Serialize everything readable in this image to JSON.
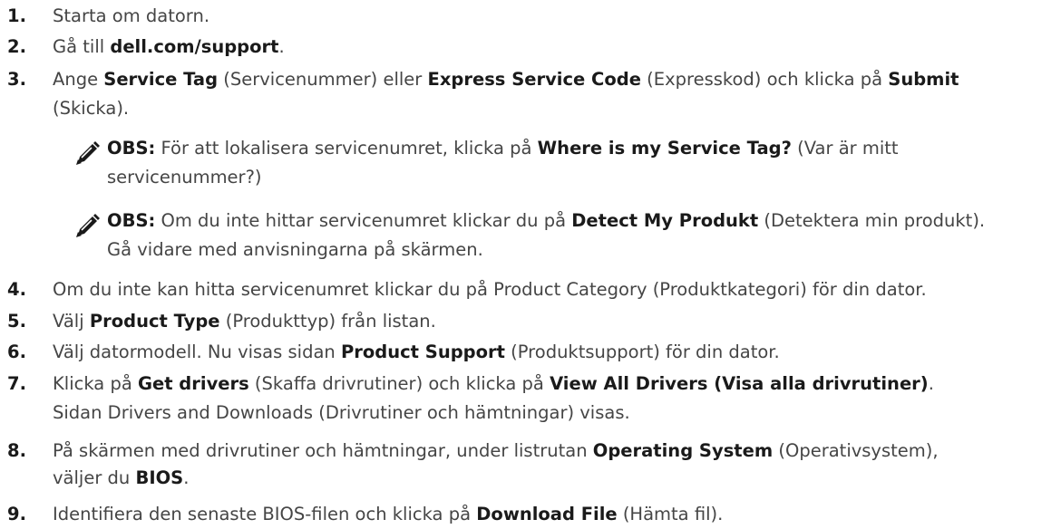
{
  "steps": [
    {
      "num": "1.",
      "parts": [
        "Starta om datorn."
      ]
    },
    {
      "num": "2.",
      "parts": [
        "Gå till ",
        "dell.com/support",
        "."
      ]
    },
    {
      "num": "3.",
      "line1": [
        "Ange ",
        "Service Tag",
        " (Servicenummer) eller ",
        "Express Service Code",
        " (Expresskod) och klicka på ",
        "Submit"
      ],
      "line2": "(Skicka)."
    },
    {
      "num": "4.",
      "parts": [
        "Om du inte kan hitta servicenumret klickar du på Product Category (Produktkategori) för din dator."
      ]
    },
    {
      "num": "5.",
      "parts": [
        "Välj ",
        "Product Type",
        " (Produkttyp) från listan."
      ]
    },
    {
      "num": "6.",
      "parts": [
        "Välj datormodell. Nu visas sidan ",
        "Product Support",
        " (Produktsupport) för din dator."
      ]
    },
    {
      "num": "7.",
      "parts": [
        "Klicka på ",
        "Get drivers",
        " (Skaffa drivrutiner) och klicka på ",
        "View All Drivers (Visa alla drivrutiner)",
        "."
      ],
      "line2": "Sidan Drivers and Downloads (Drivrutiner och hämtningar) visas."
    },
    {
      "num": "8.",
      "line1": [
        "På skärmen med drivrutiner och hämtningar, under listrutan ",
        "Operating System",
        " (Operativsystem),"
      ],
      "line2": [
        "väljer du ",
        "BIOS",
        "."
      ]
    },
    {
      "num": "9.",
      "parts": [
        "Identifiera den senaste BIOS-filen och klicka på ",
        "Download File",
        " (Hämta fil)."
      ]
    }
  ],
  "notes": [
    {
      "label": "OBS:",
      "line1": [
        " För att lokalisera servicenumret, klicka på ",
        "Where is my Service Tag?",
        " (Var är mitt"
      ],
      "line2": "servicenummer?)"
    },
    {
      "label": "OBS:",
      "line1": [
        " Om du inte hittar servicenumret klickar du på ",
        "Detect My Produkt",
        " (Detektera min produkt)."
      ],
      "line2": "Gå vidare med anvisningarna på skärmen."
    }
  ],
  "icons": {
    "note": "pencil-note-icon"
  }
}
